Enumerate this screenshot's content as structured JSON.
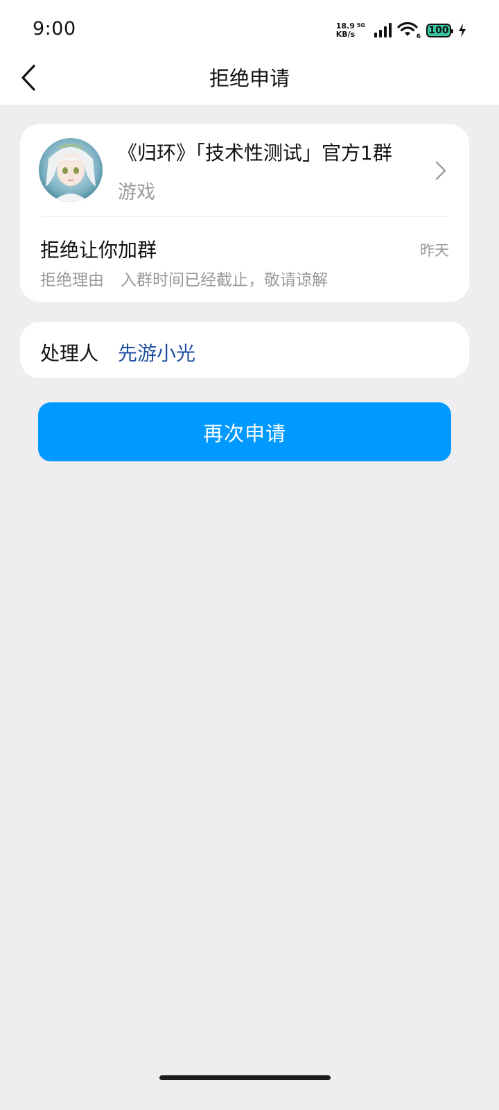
{
  "status_bar": {
    "time": "9:00",
    "net_speed_value": "18.9",
    "net_speed_unit": "KB/s",
    "network_gen": "5G",
    "wifi_badge": "6",
    "battery_level": "100",
    "battery_color": "#38c7a2"
  },
  "nav": {
    "title": "拒绝申请",
    "back_icon": "chevron-left-icon"
  },
  "group": {
    "name": "《归环》「技术性测试」官方1群",
    "category": "游戏",
    "chevron_icon": "chevron-right-icon"
  },
  "rejection": {
    "title": "拒绝让你加群",
    "time": "昨天",
    "reason_label": "拒绝理由",
    "reason_text": "入群时间已经截止，敬请谅解"
  },
  "handler": {
    "label": "处理人",
    "name": "先游小光"
  },
  "actions": {
    "reapply_label": "再次申请"
  },
  "colors": {
    "accent": "#0099ff",
    "link": "#1b4ea0",
    "background": "#eeeef1",
    "secondary_text": "#9a9a9f"
  }
}
